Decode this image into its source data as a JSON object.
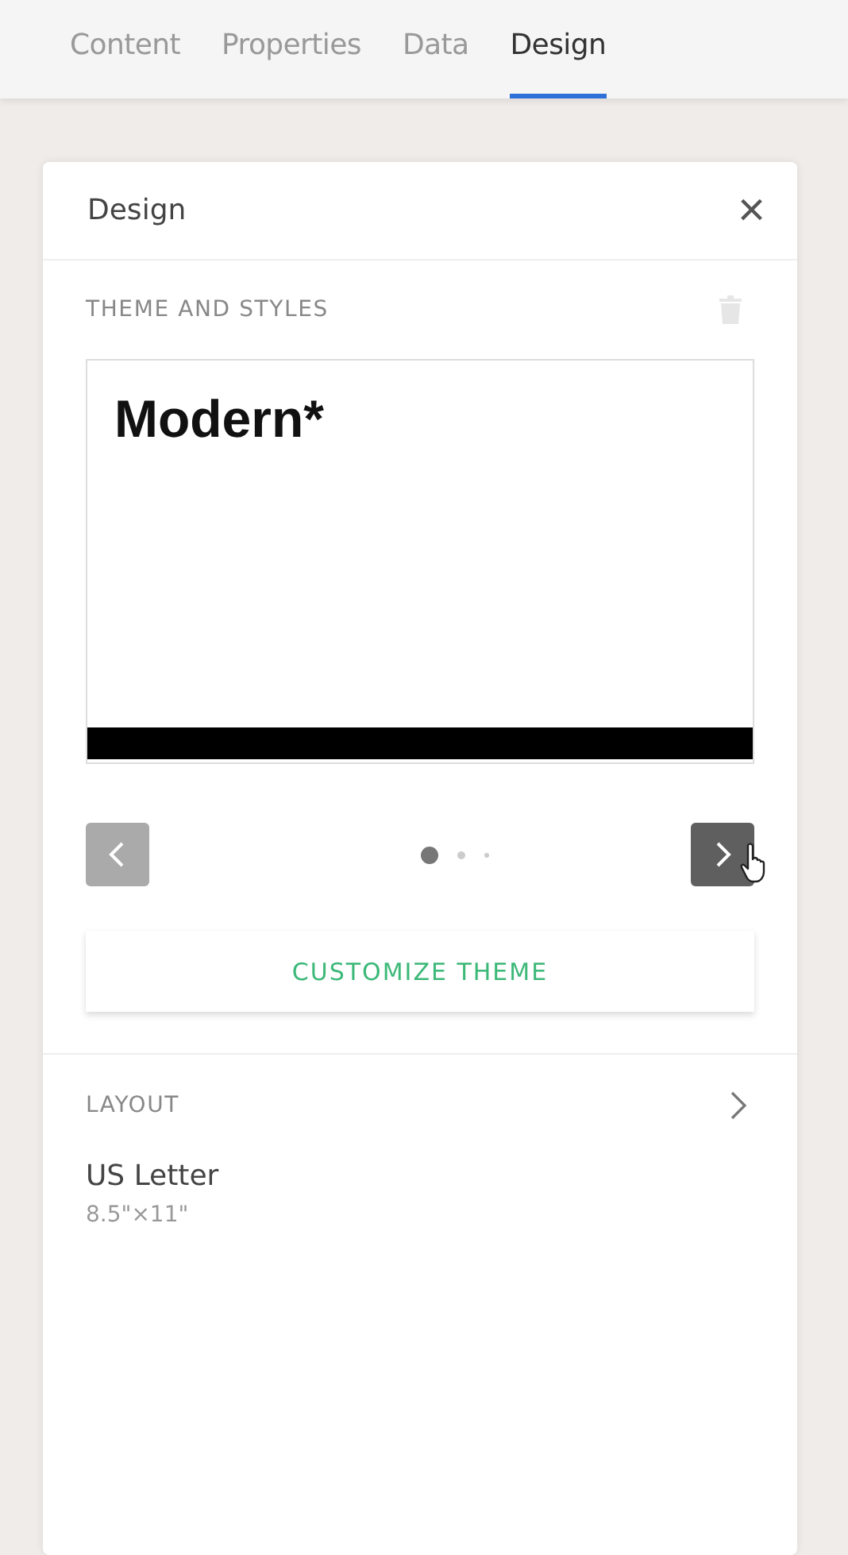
{
  "tabs": [
    {
      "label": "Content",
      "selected": false
    },
    {
      "label": "Properties",
      "selected": false
    },
    {
      "label": "Data",
      "selected": false
    },
    {
      "label": "Design",
      "selected": true
    }
  ],
  "panel": {
    "title": "Design",
    "close": "×",
    "theme": {
      "heading": "THEME AND STYLES",
      "name": "Modern*",
      "carousel": {
        "prev_disabled": true,
        "next_disabled": false,
        "dots": [
          {
            "selected": true
          },
          {
            "selected": false
          },
          {
            "selected": false
          }
        ]
      },
      "button": "CUSTOMIZE THEME"
    },
    "layout": {
      "heading": "LAYOUT",
      "name": "US Letter",
      "size": "8.5\"×11\""
    }
  }
}
